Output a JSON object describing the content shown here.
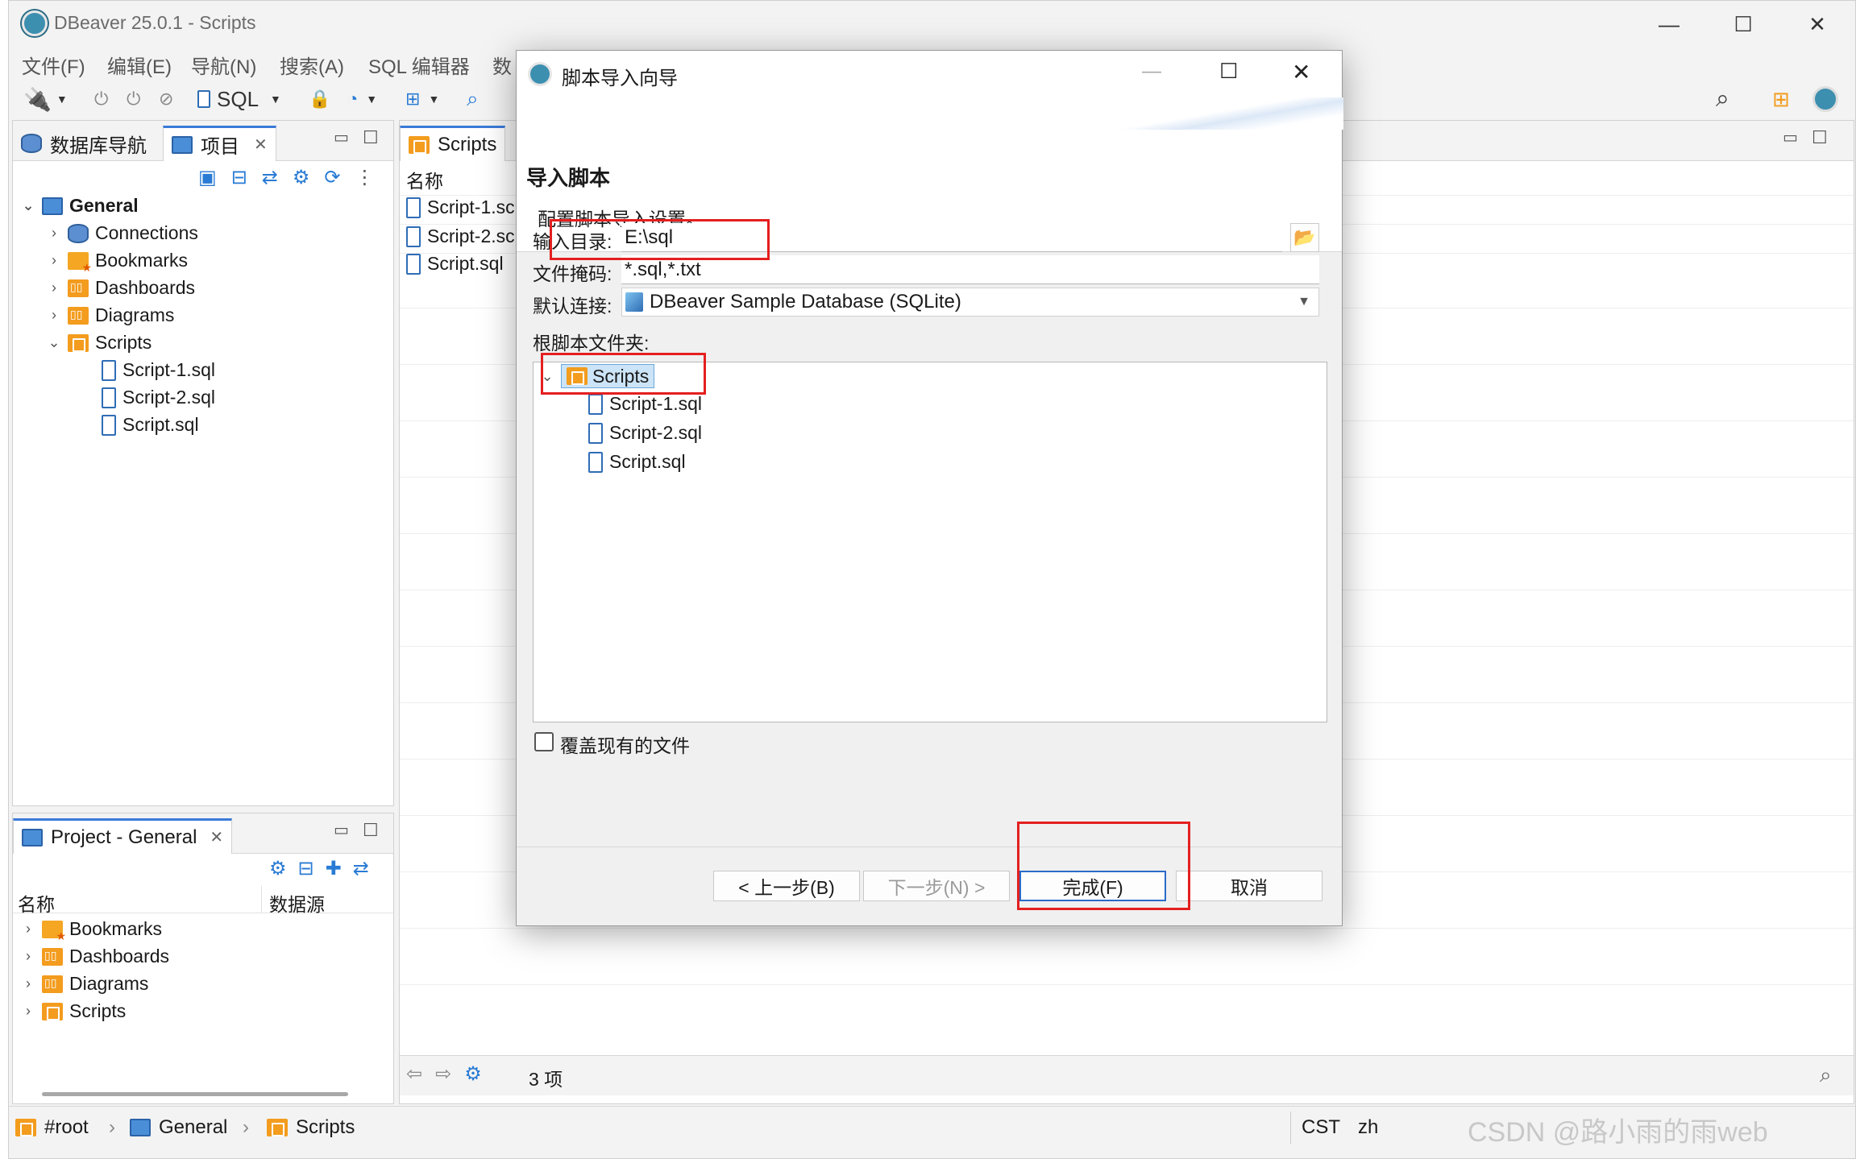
{
  "window": {
    "title": "DBeaver 25.0.1 - Scripts",
    "min": "—",
    "max": "☐",
    "close": "✕"
  },
  "menu": [
    "文件(F)",
    "编辑(E)",
    "导航(N)",
    "搜索(A)",
    "SQL 编辑器",
    "数"
  ],
  "toolbar": {
    "sql_label": "SQL"
  },
  "left_panel": {
    "tabs": [
      "数据库导航",
      "项目"
    ],
    "tree": {
      "root": "General",
      "children": [
        "Connections",
        "Bookmarks",
        "Dashboards",
        "Diagrams",
        "Scripts"
      ],
      "scripts": [
        "Script-1.sql",
        "Script-2.sql",
        "Script.sql"
      ]
    }
  },
  "project_panel": {
    "tab": "Project - General",
    "columns": [
      "名称",
      "数据源"
    ],
    "items": [
      "Bookmarks",
      "Dashboards",
      "Diagrams",
      "Scripts"
    ]
  },
  "editor": {
    "tab": "Scripts",
    "column": "名称",
    "files": [
      "Script-1.sc",
      "Script-2.sc",
      "Script.sql"
    ],
    "count": "3 项"
  },
  "statusbar": {
    "crumbs": [
      "#root",
      "General",
      "Scripts"
    ],
    "tz": "CST",
    "lang": "zh",
    "watermark": "CSDN @路小雨的雨web"
  },
  "dialog": {
    "title": "脚本导入向导",
    "heading": "导入脚本",
    "subheading": "配置脚本导入设置。",
    "input_dir_label": "输入目录:",
    "input_dir_value": "E:\\sql",
    "mask_label": "文件掩码:",
    "mask_value": "*.sql,*.txt",
    "conn_label": "默认连接:",
    "conn_value": "DBeaver Sample Database (SQLite)",
    "root_folder_label": "根脚本文件夹:",
    "tree_root": "Scripts",
    "tree_files": [
      "Script-1.sql",
      "Script-2.sql",
      "Script.sql"
    ],
    "overwrite_label": "覆盖现有的文件",
    "btn_back": "< 上一步(B)",
    "btn_next": "下一步(N) >",
    "btn_finish": "完成(F)",
    "btn_cancel": "取消"
  }
}
